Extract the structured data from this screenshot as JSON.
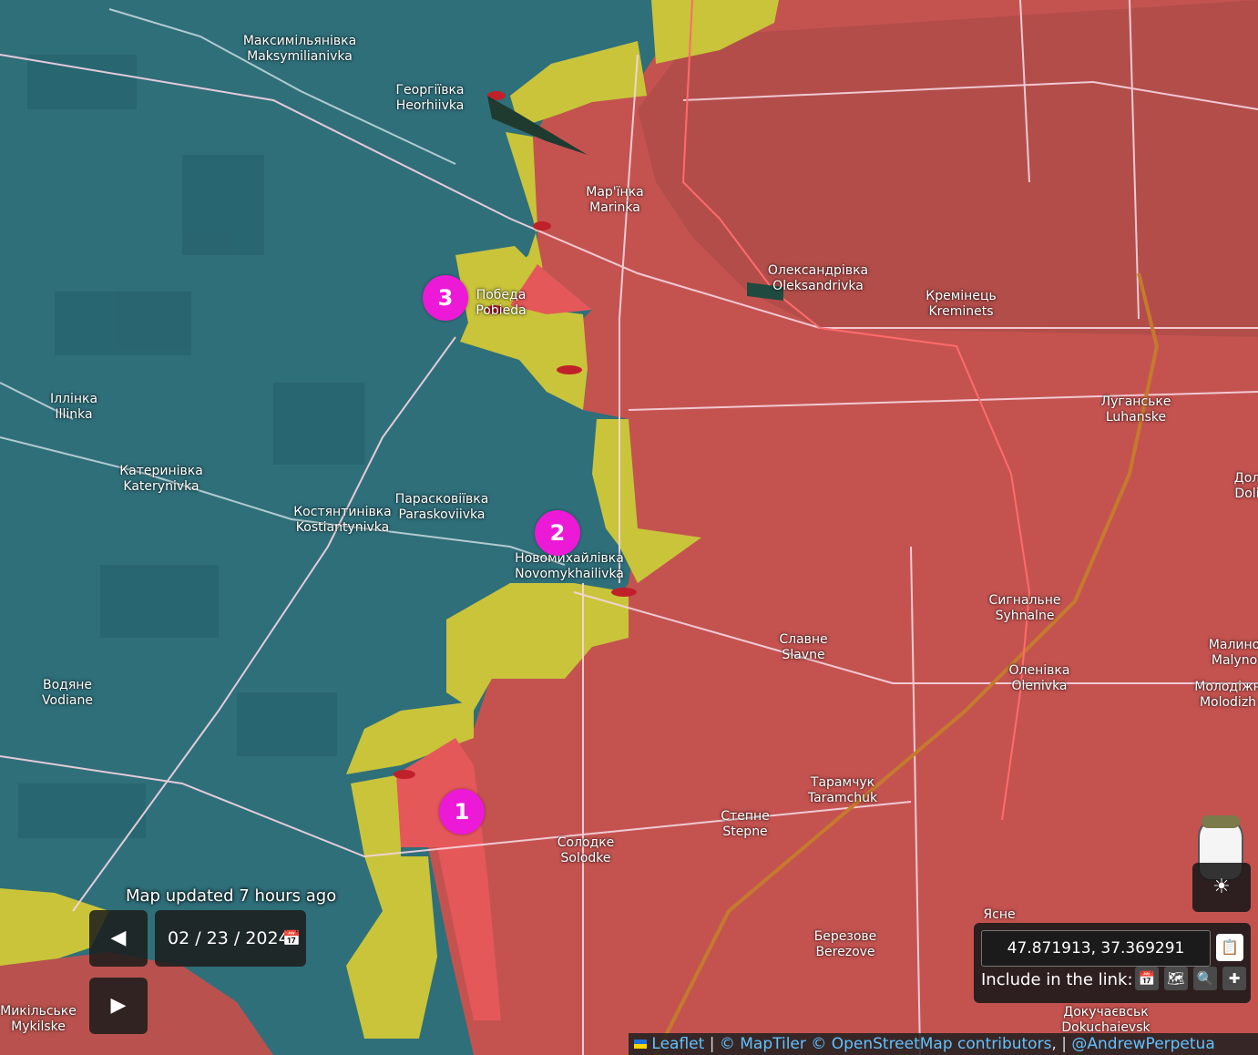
{
  "places": [
    {
      "id": "maksymilianivka",
      "ua": "Максимільянівка",
      "en": "Maksymilianivka"
    },
    {
      "id": "heorhiivka",
      "ua": "Георгіївка",
      "en": "Heorhiivka"
    },
    {
      "id": "marinka",
      "ua": "Мар'їнка",
      "en": "Marinka"
    },
    {
      "id": "oleksandrivka",
      "ua": "Олександрівка",
      "en": "Oleksandrivka"
    },
    {
      "id": "kreminets",
      "ua": "Кремінець",
      "en": "Kreminets"
    },
    {
      "id": "pobeda",
      "ua": "Победа",
      "en": "Pobieda"
    },
    {
      "id": "illinka",
      "ua": "Іллінка",
      "en": "Illinka"
    },
    {
      "id": "luhanske",
      "ua": "Луганське",
      "en": "Luhanske"
    },
    {
      "id": "katerynivka",
      "ua": "Катеринівка",
      "en": "Katerynivka"
    },
    {
      "id": "kostiantynivka",
      "ua": "Костянтинівка",
      "en": "Kostiantynivka"
    },
    {
      "id": "paraskoviivka",
      "ua": "Парасковіївка",
      "en": "Paraskoviivka"
    },
    {
      "id": "novomykhailivka",
      "ua": "Новомихайлівка",
      "en": "Novomykhailivka"
    },
    {
      "id": "dol",
      "ua": "Дол",
      "en": "Doli"
    },
    {
      "id": "syhnalne",
      "ua": "Сигнальне",
      "en": "Syhnalne"
    },
    {
      "id": "slavne",
      "ua": "Славне",
      "en": "Slavne"
    },
    {
      "id": "vodiane",
      "ua": "Водяне",
      "en": "Vodiane"
    },
    {
      "id": "olenivka",
      "ua": "Оленівка",
      "en": "Olenivka"
    },
    {
      "id": "malyn",
      "ua": "Малино",
      "en": "Malyno"
    },
    {
      "id": "molodizh",
      "ua": "Молодіжн",
      "en": "Molodizh"
    },
    {
      "id": "taramchuk",
      "ua": "Тарамчук",
      "en": "Taramchuk"
    },
    {
      "id": "stepne",
      "ua": "Степне",
      "en": "Stepne"
    },
    {
      "id": "solodke",
      "ua": "Солодке",
      "en": "Solodke"
    },
    {
      "id": "yasne",
      "ua": "Ясне",
      "en": ""
    },
    {
      "id": "berezove",
      "ua": "Березове",
      "en": "Berezove"
    },
    {
      "id": "dokuchaievsk",
      "ua": "Докучаєвськ",
      "en": "Dokuchaievsk"
    },
    {
      "id": "mykilske",
      "ua": "Микільське",
      "en": "Mykilske"
    }
  ],
  "markers": [
    {
      "label": "1"
    },
    {
      "label": "2"
    },
    {
      "label": "3"
    }
  ],
  "status": {
    "updated": "Map updated 7 hours ago"
  },
  "date": {
    "value": "02 / 23 / 2024"
  },
  "controls": {
    "prev": "◀",
    "next": "▶",
    "calendar_icon": "calendar-icon"
  },
  "coords": {
    "value": "47.871913, 37.369291",
    "include_label": "Include in the link:"
  },
  "attribution": {
    "leaflet": "Leaflet",
    "maptiler": "© MapTiler",
    "osm": "© OpenStreetMap contributors",
    "author": "@AndrewPerpetua",
    "sep": "|"
  },
  "colors": {
    "ukraine_controlled": "#2f6f7a",
    "russia_controlled": "#c45350",
    "contested": "#c9c43a",
    "roads": "#f6d6e2",
    "front_line": "#ff5a5a",
    "marker": "#ec1ad6"
  }
}
